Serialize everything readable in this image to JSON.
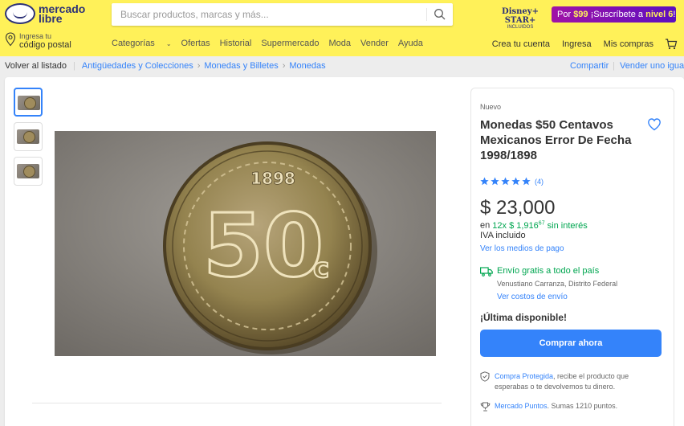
{
  "header": {
    "logo_line1": "mercado",
    "logo_line2": "libre",
    "search_placeholder": "Buscar productos, marcas y más...",
    "disney_line1": "Disney+ STAR+",
    "disney_line2": "INCLUIDOS",
    "promo_prefix": "Por ",
    "promo_price": "$99",
    "promo_mid": " ¡Suscríbete a ",
    "promo_level": "nivel 6",
    "promo_suffix": "!",
    "location_line1": "Ingresa tu",
    "location_line2": "código postal",
    "nav": [
      "Categorías",
      "Ofertas",
      "Historial",
      "Supermercado",
      "Moda",
      "Vender",
      "Ayuda"
    ],
    "user_nav": [
      "Crea tu cuenta",
      "Ingresa",
      "Mis compras"
    ]
  },
  "breadcrumbs": {
    "back": "Volver al listado",
    "items": [
      "Antigüedades y Colecciones",
      "Monedas y Billetes",
      "Monedas"
    ],
    "share": "Compartir",
    "sell": "Vender uno igual"
  },
  "product": {
    "condition": "Nuevo",
    "title": "Monedas $50 Centavos Mexicanos Error De Fecha 1998/1898",
    "rating_count": "(4)",
    "price": "$ 23,000",
    "installments_prefix": "en ",
    "installments_green": "12x $ 1,916",
    "installments_cents": "67",
    "installments_suffix": " sin interés",
    "iva": "IVA incluido",
    "payments_link": "Ver los medios de pago",
    "shipping": "Envío gratis a todo el país",
    "shipping_location": "Venustiano Carranza, Distrito Federal",
    "shipping_costs_link": "Ver costos de envío",
    "stock": "¡Última disponible!",
    "buy_button": "Comprar ahora",
    "protection_link": "Compra Protegida",
    "protection_text": ", recibe el producto que esperabas o te devolvemos tu dinero.",
    "points_link": "Mercado Puntos",
    "points_text": ". Sumas 1210 puntos.",
    "coin_year": "1898",
    "coin_value": "50",
    "coin_unit": "c"
  },
  "colors": {
    "header_bg": "#fff159",
    "accent": "#3483fa",
    "success": "#00a650"
  }
}
